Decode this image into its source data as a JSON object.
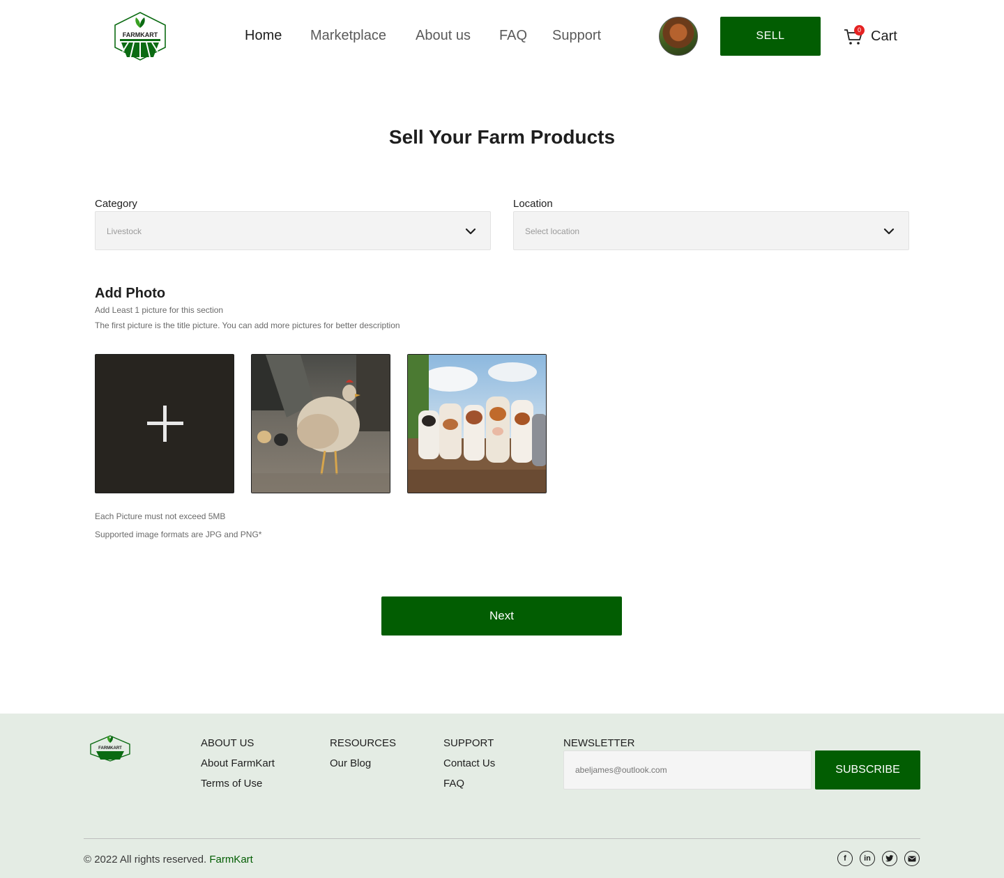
{
  "brand": {
    "logo_text": "FARMKART",
    "primary_color": "#025d02"
  },
  "nav": {
    "items": [
      {
        "label": "Home",
        "active": true
      },
      {
        "label": "Marketplace",
        "active": false
      },
      {
        "label": "About us",
        "active": false
      },
      {
        "label": "FAQ",
        "active": false
      },
      {
        "label": "Support",
        "active": false
      }
    ]
  },
  "header": {
    "sell_label": "SELL",
    "cart_label": "Cart",
    "cart_count": "0"
  },
  "main": {
    "title": "Sell Your Farm Products",
    "category": {
      "label": "Category",
      "value": "Livestock"
    },
    "location": {
      "label": "Location",
      "placeholder": "Select location"
    },
    "photo_section": {
      "title": "Add Photo",
      "hint1": "Add Least 1 picture for this section",
      "hint2": "The first picture is the title picture. You can add more pictures for better description",
      "note1": "Each Picture must not exceed 5MB",
      "note2": "Supported image formats are JPG and PNG*"
    },
    "next_label": "Next"
  },
  "footer": {
    "about": {
      "heading": "ABOUT US",
      "links": [
        "About FarmKart",
        "Terms of Use"
      ]
    },
    "resources": {
      "heading": "RESOURCES",
      "links": [
        "Our Blog"
      ]
    },
    "support": {
      "heading": "SUPPORT",
      "links": [
        "Contact Us",
        "FAQ"
      ]
    },
    "newsletter": {
      "heading": "NEWSLETTER",
      "placeholder": "abeljames@outlook.com",
      "button": "SUBSCRIBE"
    },
    "copyright": "© 2022 All rights reserved.",
    "copyright_brand": "FarmKart",
    "socials": [
      "facebook-icon",
      "linkedin-icon",
      "twitter-icon",
      "mail-icon"
    ]
  }
}
